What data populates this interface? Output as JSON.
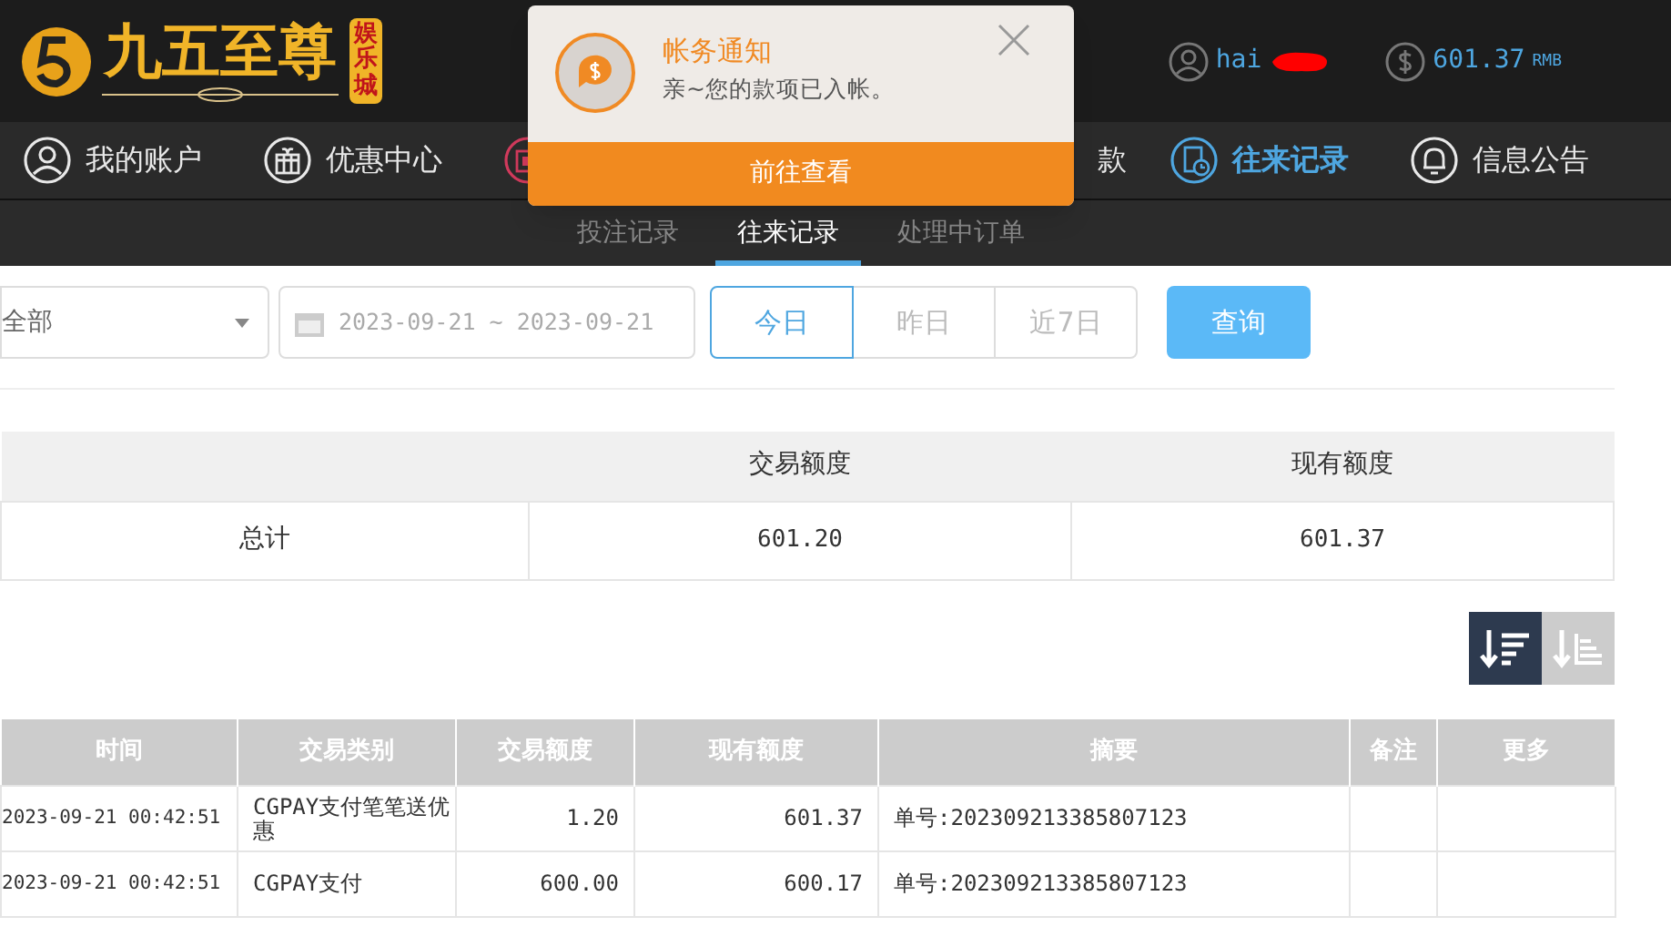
{
  "logo": {
    "name": "九五至尊",
    "badge": "娱乐城"
  },
  "user": {
    "name": "hai",
    "balance": "601.37",
    "currency": "RMB"
  },
  "nav": [
    {
      "kind": "item",
      "label": "我的账户",
      "selected": false
    },
    {
      "kind": "item",
      "label": "优惠中心",
      "selected": false
    },
    {
      "kind": "icon"
    },
    {
      "kind": "text",
      "label": "款",
      "selected": false
    },
    {
      "kind": "item",
      "label": "往来记录",
      "selected": true
    },
    {
      "kind": "item",
      "label": "信息公告",
      "selected": false
    }
  ],
  "notification": {
    "title": "帐务通知",
    "message": "亲~您的款项已入帐。",
    "action": "前往查看"
  },
  "subtabs": [
    {
      "label": "投注记录",
      "selected": false
    },
    {
      "label": "往来记录",
      "selected": true
    },
    {
      "label": "处理中订单",
      "selected": false
    }
  ],
  "filters": {
    "type": "全部",
    "date_range": "2023-09-21 ~ 2023-09-21",
    "quick": [
      {
        "label": "今日",
        "selected": true
      },
      {
        "label": "昨日",
        "selected": false
      },
      {
        "label": "近7日",
        "selected": false
      }
    ],
    "search": "查询"
  },
  "summary": {
    "columns": [
      "",
      "交易额度",
      "现有额度"
    ],
    "rows": [
      [
        "总计",
        "601.20",
        "601.37"
      ]
    ]
  },
  "sort": [
    {
      "selected": true
    },
    {
      "selected": false
    }
  ],
  "table": {
    "columns": [
      "时间",
      "交易类别",
      "交易额度",
      "现有额度",
      "摘要",
      "备注",
      "更多"
    ],
    "rows": [
      [
        "2023-09-21 00:42:51",
        "CGPAY支付笔笔送优惠",
        "1.20",
        "601.37",
        "单号:202309213385807123"
      ],
      [
        "2023-09-21 00:42:51",
        "CGPAY支付",
        "600.00",
        "600.17",
        "单号:202309213385807123"
      ]
    ]
  }
}
